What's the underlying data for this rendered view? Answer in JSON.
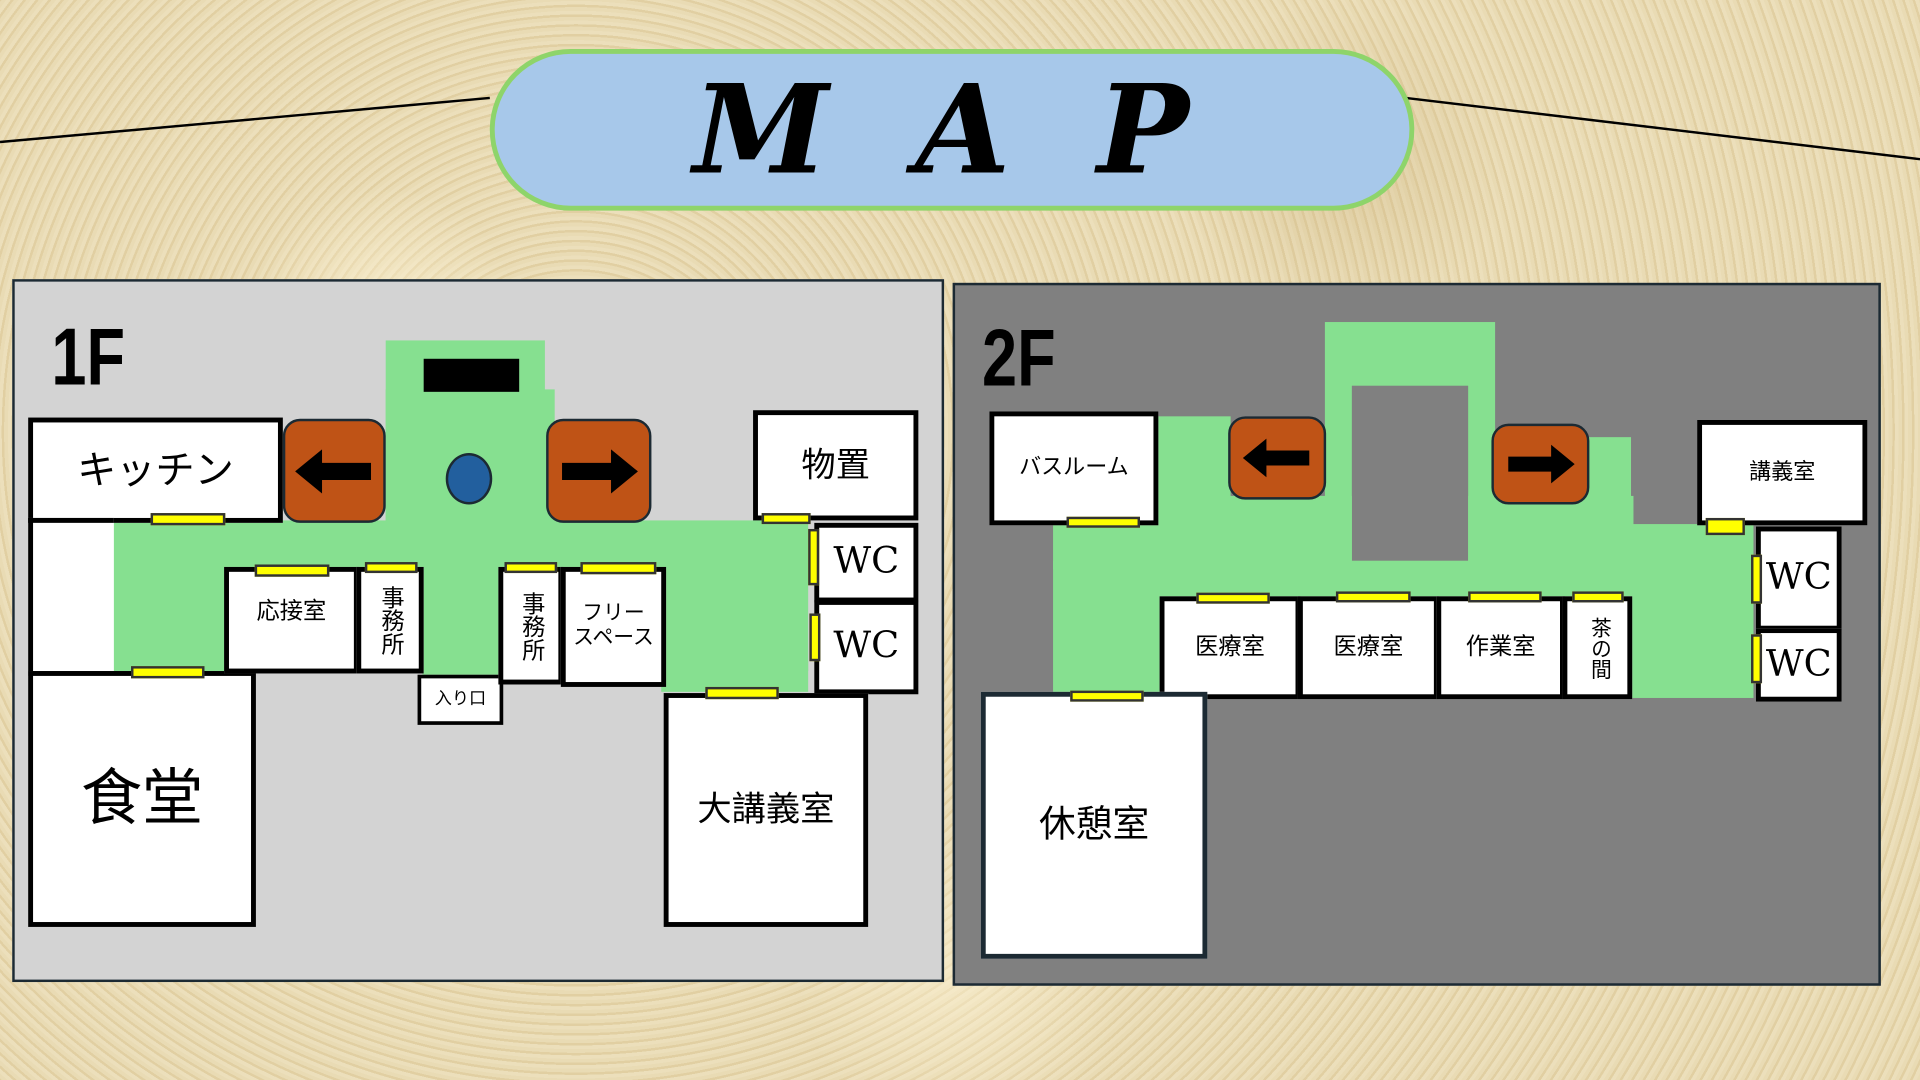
{
  "title": "M A P",
  "floor1": {
    "label": "1F",
    "rooms": {
      "kitchen": "キッチン",
      "dining": "食堂",
      "reception": "応接室",
      "office1": "事務所",
      "entrance": "入り口",
      "office2": "事務所",
      "free_space": "フリースペース",
      "storage": "物置",
      "wc1": "WC",
      "wc2": "WC",
      "large_lecture": "大講義室"
    }
  },
  "floor2": {
    "label": "2F",
    "rooms": {
      "bathroom": "バスルーム",
      "lecture": "講義室",
      "wc1": "WC",
      "wc2": "WC",
      "medical1": "医療室",
      "medical2": "医療室",
      "workroom": "作業室",
      "tea_room": "茶の間",
      "lounge": "休憩室"
    }
  },
  "colors": {
    "corridor": "#86e090",
    "door": "#ffff00",
    "stairs_button": "#bf5316",
    "floor1_bg": "#d3d3d3",
    "floor2_bg": "#808080",
    "title_bg": "#a7c8ea"
  },
  "icons": {
    "left": "arrow-left-icon",
    "right": "arrow-right-icon",
    "marker": "blue-circle-marker"
  }
}
